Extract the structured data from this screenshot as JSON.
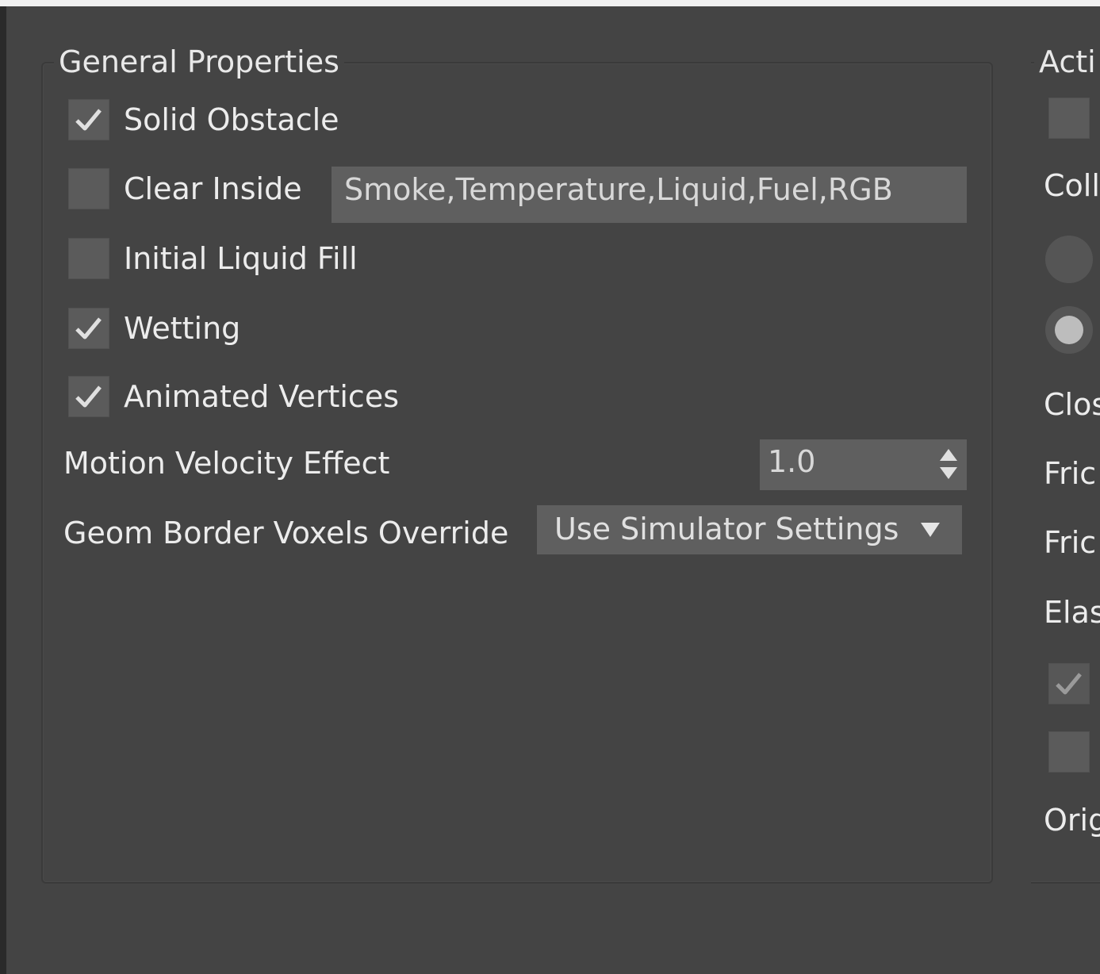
{
  "general": {
    "title": "General Properties",
    "checkboxes": [
      {
        "label": "Solid Obstacle",
        "checked": true
      },
      {
        "label": "Clear Inside",
        "checked": false
      },
      {
        "label": "Initial Liquid Fill",
        "checked": false
      },
      {
        "label": "Wetting",
        "checked": true
      },
      {
        "label": "Animated Vertices",
        "checked": true
      }
    ],
    "clear_inside_value": "Smoke,Temperature,Liquid,Fuel,RGB",
    "motion_velocity_label": "Motion Velocity Effect",
    "motion_velocity_value": "1.0",
    "geom_border_label": "Geom Border Voxels Override",
    "geom_border_value": "Use Simulator Settings"
  },
  "right_group": {
    "title": "Acti",
    "label_coll": "Coll",
    "label_clos": "Clos",
    "label_fric1": "Fric",
    "label_fric2": "Fric",
    "label_elas": "Elas",
    "label_orig": "Orig"
  },
  "colors": {
    "panel": "#444444",
    "field": "#5f5f5f",
    "checkbox": "#5b5b5b",
    "text": "#ececec"
  }
}
